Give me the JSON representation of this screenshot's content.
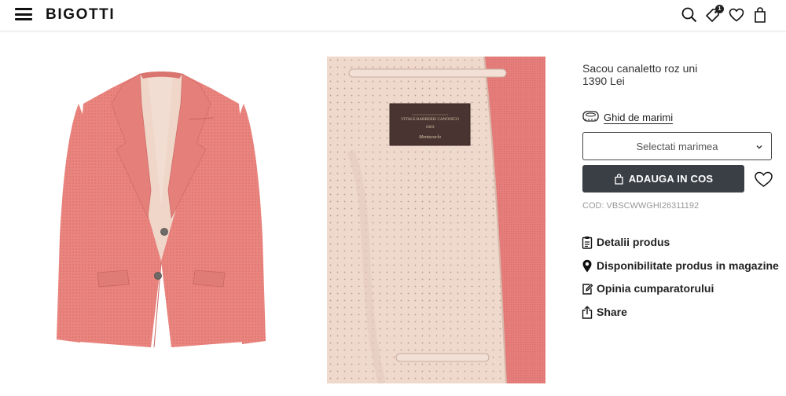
{
  "header": {
    "logo": "BIGOTTI",
    "menu_icon": "hamburger-menu-icon",
    "icons": [
      "search-icon",
      "tag-icon",
      "heart-icon",
      "shopping-bag-icon"
    ],
    "tag_badge_count": "1"
  },
  "product": {
    "title": "Sacou canaletto roz uni",
    "price": "1390 Lei",
    "size_guide_label": "Ghid de marimi",
    "size_select_placeholder": "Selectati marimea",
    "add_to_cart_label": "ADAUGA IN COS",
    "code": "COD: VBSCWWGHI26311192"
  },
  "gallery": {
    "jacket_color": "#e8847f",
    "lining_color": "#efd5ca",
    "label_line1": "VITALE BARBERIS CANONICO",
    "label_line2": "1663",
    "label_line3": "Montecarlo"
  },
  "details_links": [
    {
      "label": "Detalii produs",
      "icon": "clipboard-icon"
    },
    {
      "label": "Disponibilitate produs in magazine",
      "icon": "map-pin-icon"
    },
    {
      "label": "Opinia cumparatorului",
      "icon": "edit-icon"
    },
    {
      "label": "Share",
      "icon": "share-icon"
    }
  ]
}
